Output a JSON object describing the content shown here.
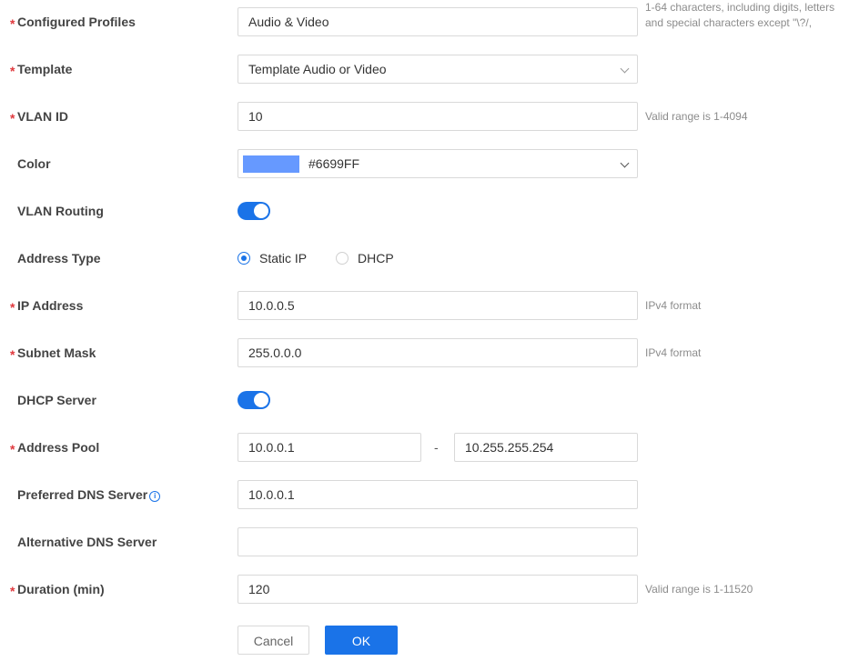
{
  "form": {
    "required_mark": "*",
    "configured_profiles": {
      "label": "Configured Profiles",
      "value": "Audio & Video",
      "hint": "1-64 characters, including digits, letters and special characters except \"\\?/,"
    },
    "template": {
      "label": "Template",
      "value": "Template Audio or Video"
    },
    "vlan_id": {
      "label": "VLAN ID",
      "value": "10",
      "hint": "Valid range is 1-4094"
    },
    "color": {
      "label": "Color",
      "value": "#6699FF",
      "swatch": "#6699FF"
    },
    "vlan_routing": {
      "label": "VLAN Routing",
      "enabled": true
    },
    "address_type": {
      "label": "Address Type",
      "options": [
        {
          "label": "Static IP",
          "selected": true
        },
        {
          "label": "DHCP",
          "selected": false
        }
      ]
    },
    "ip_address": {
      "label": "IP Address",
      "value": "10.0.0.5",
      "hint": "IPv4 format"
    },
    "subnet_mask": {
      "label": "Subnet Mask",
      "value": "255.0.0.0",
      "hint": "IPv4 format"
    },
    "dhcp_server": {
      "label": "DHCP Server",
      "enabled": true
    },
    "address_pool": {
      "label": "Address Pool",
      "start": "10.0.0.1",
      "separator": "-",
      "end": "10.255.255.254"
    },
    "preferred_dns": {
      "label": "Preferred DNS Server",
      "value": "10.0.0.1"
    },
    "alternative_dns": {
      "label": "Alternative DNS Server",
      "value": ""
    },
    "duration": {
      "label": "Duration (min)",
      "value": "120",
      "hint": "Valid range is 1-11520"
    }
  },
  "buttons": {
    "cancel": "Cancel",
    "ok": "OK"
  },
  "colors": {
    "accent": "#1a73e8",
    "required": "#e0393e"
  }
}
